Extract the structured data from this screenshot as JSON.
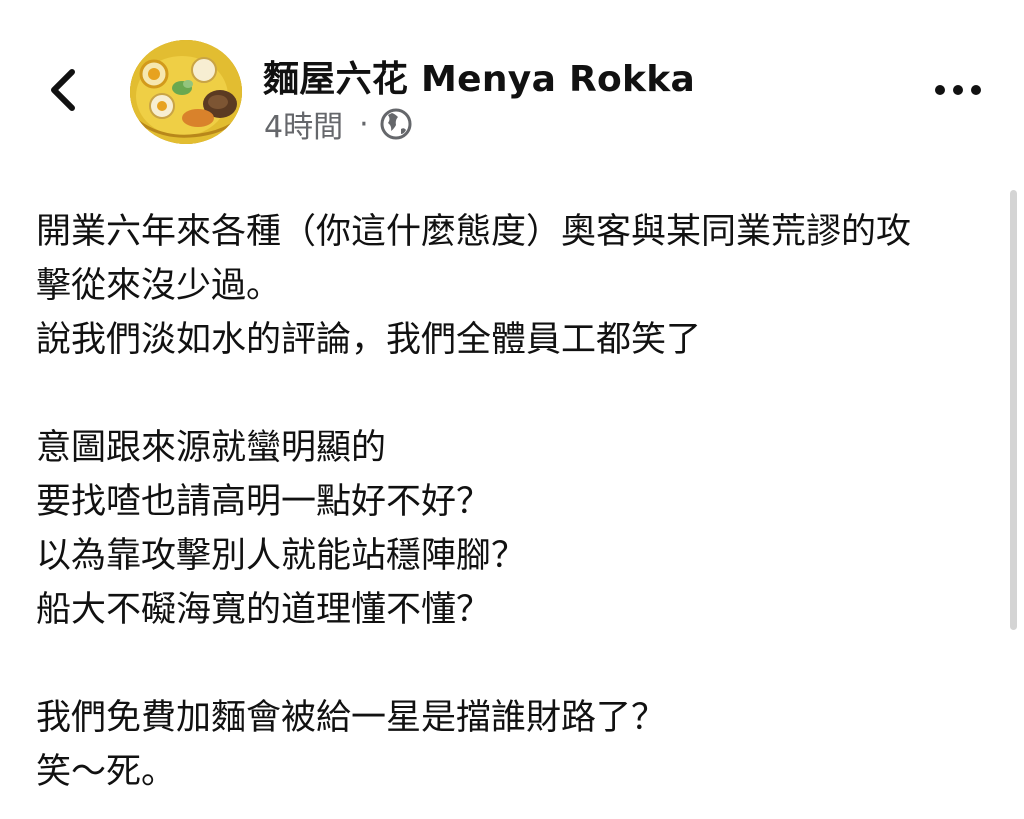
{
  "header": {
    "page_name": "麵屋六花 Menya Rokka",
    "time_ago": "4時間",
    "separator": "·",
    "back_icon": "chevron-left-icon",
    "privacy_icon": "globe-icon",
    "more_icon": "more-horizontal-icon"
  },
  "post": {
    "lines": [
      "開業六年來各種（你這什麼態度）奧客與某同業荒謬的攻",
      "擊從來沒少過。",
      "說我們淡如水的評論，我們全體員工都笑了",
      "",
      "意圖跟來源就蠻明顯的",
      "要找喳也請高明一點好不好？",
      "以為靠攻擊別人就能站穩陣腳？",
      "船大不礙海寬的道理懂不懂？",
      "",
      "我們免費加麵會被給一星是擋誰財路了？",
      "笑～死。"
    ]
  },
  "colors": {
    "text": "#111111",
    "meta": "#65676b",
    "scrollbar": "#d4d4d4",
    "background": "#ffffff"
  }
}
